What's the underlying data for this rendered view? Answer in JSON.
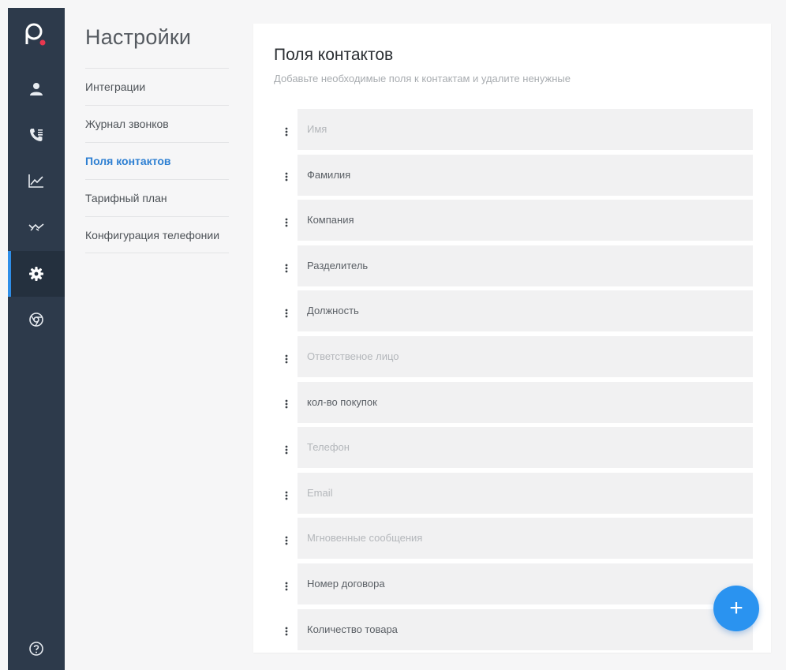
{
  "rail": {
    "icons": [
      "user-icon",
      "call-log-icon",
      "chart-line-icon",
      "pulse-icon",
      "settings-gear-icon",
      "chrome-icon",
      "help-icon"
    ],
    "active_index": 4,
    "accent_color": "#2f8ee8",
    "logo_dot_color": "#e9374f"
  },
  "subnav": {
    "title": "Настройки",
    "items": [
      {
        "label": "Интеграции"
      },
      {
        "label": "Журнал звонков"
      },
      {
        "label": "Поля контактов"
      },
      {
        "label": "Тарифный план"
      },
      {
        "label": "Конфигурация телефонии"
      }
    ],
    "active_index": 2
  },
  "main": {
    "title": "Поля контактов",
    "subtitle": "Добавьте необходимые поля к контактам и удалите ненужные",
    "fields": [
      {
        "text": "Имя",
        "placeholder": true
      },
      {
        "text": "Фамилия",
        "placeholder": false
      },
      {
        "text": "Компания",
        "placeholder": false
      },
      {
        "text": "Разделитель",
        "placeholder": false
      },
      {
        "text": "Должность",
        "placeholder": false
      },
      {
        "text": "Ответственое лицо",
        "placeholder": true
      },
      {
        "text": "кол-во покупок",
        "placeholder": false
      },
      {
        "text": "Телефон",
        "placeholder": true
      },
      {
        "text": "Email",
        "placeholder": true
      },
      {
        "text": "Мгновенные сообщения",
        "placeholder": true
      },
      {
        "text": "Номер договора",
        "placeholder": false
      },
      {
        "text": "Количество товара",
        "placeholder": false
      }
    ],
    "fab_label": "+"
  }
}
